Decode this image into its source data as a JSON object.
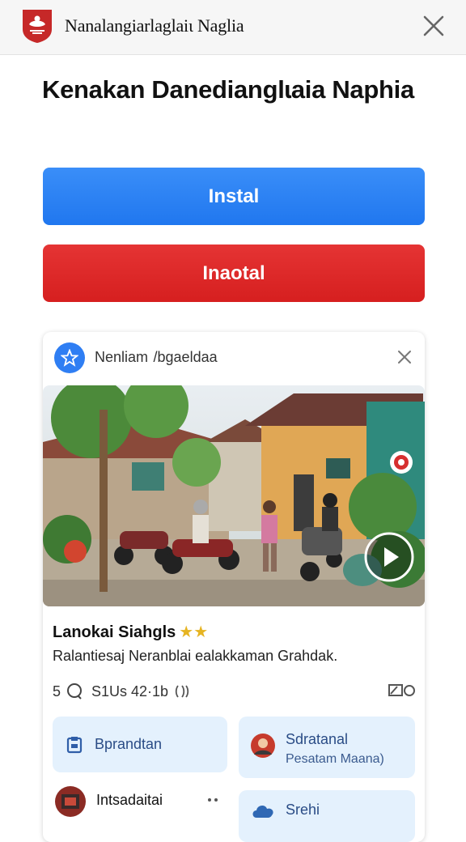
{
  "header": {
    "app_title": "Nanalangiarlaglaiι Naglia"
  },
  "headline": "Kenakan Danedianglɩaia Naphia",
  "buttons": {
    "primary": "Instal",
    "secondary": "Inaotal"
  },
  "card": {
    "source": "Nenliam  /bgaeldaa",
    "listing_title": "Lanokai Siahgls",
    "rating_stars": "★★",
    "listing_subtitle": "Ralantiesaj Neranblai ealakkaman Grahdak.",
    "meta_left_count": "5",
    "meta_middle": "S1Us 42·1b",
    "tiles": [
      {
        "label": "Bprandtan",
        "icon": "clipboard-icon"
      },
      {
        "label": "Sdratanal",
        "sub": "Pesatam Maana)",
        "icon": "avatar"
      },
      {
        "label": "Intsadaitai",
        "icon": "avatar"
      },
      {
        "label": "Srehi",
        "icon": "cloud-icon"
      }
    ]
  },
  "colors": {
    "blue": "#2a7ff1",
    "red": "#db2525",
    "tile_bg": "#e4f1fd",
    "star": "#e6b422"
  }
}
